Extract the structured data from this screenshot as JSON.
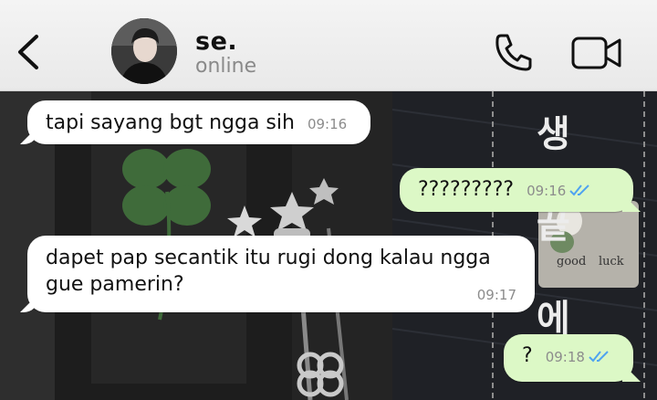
{
  "header": {
    "contact_name": "se.",
    "contact_status": "online"
  },
  "icons": {
    "back": "chevron-left-icon",
    "call": "phone-icon",
    "video": "video-camera-icon",
    "read": "double-check-icon"
  },
  "colors": {
    "header_bg": "#f2f2f2",
    "incoming_bubble": "#ffffff",
    "outgoing_bubble": "#dcf8c6",
    "read_tick": "#4fa3f0"
  },
  "wallpaper": {
    "korean_text": [
      "생",
      "끝",
      "에"
    ],
    "card_text": [
      "good",
      "luck"
    ]
  },
  "messages": [
    {
      "direction": "in",
      "text": "tapi sayang bgt ngga sih",
      "time": "09:16"
    },
    {
      "direction": "out",
      "text": "?????????",
      "time": "09:16",
      "read": true
    },
    {
      "direction": "in",
      "text": "dapet pap secantik itu rugi dong kalau ngga gue pamerin?",
      "time": "09:17"
    },
    {
      "direction": "out",
      "text": "?",
      "time": "09:18",
      "read": true
    }
  ]
}
